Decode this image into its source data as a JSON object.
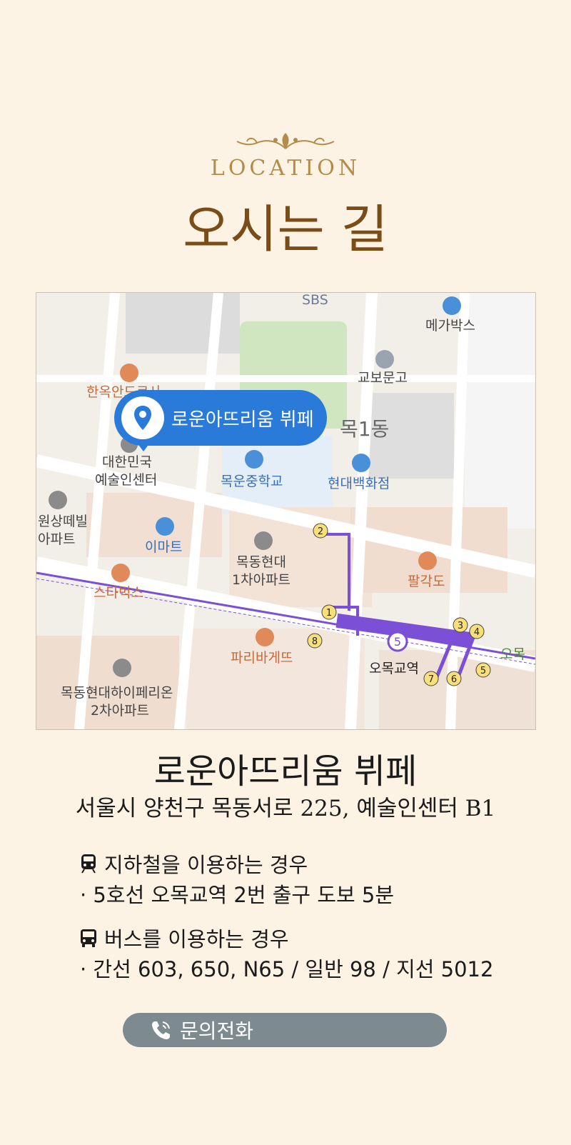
{
  "header": {
    "section_label": "LOCATION",
    "title": "오시는 길"
  },
  "map": {
    "pin_label": "로운아뜨리움 뷔페",
    "labels": {
      "sbs": "SBS",
      "megabox": "메가박스",
      "kyobo": "교보문고",
      "hanok": "한옥안드로사",
      "mok1dong": "목1동",
      "arts_center": [
        "대한민국",
        "예술인센터"
      ],
      "mogun_school": "목운중학교",
      "hyundai_dept": "현대백화점",
      "wonsang_apt": [
        "원상떼빌",
        "아파트"
      ],
      "emart": "이마트",
      "mokdong_hyundai": [
        "목동현대",
        "1차아파트"
      ],
      "palgakdo": "팔각도",
      "starbucks": "스타벅스",
      "paris": "파리바게뜨",
      "omok_station": "오목교역",
      "omok_edge": "오목",
      "imperion": [
        "목동현대하이페리온",
        "2차아파트"
      ],
      "line_num": "5",
      "exits": [
        "1",
        "2",
        "3",
        "4",
        "5",
        "6",
        "7",
        "8"
      ]
    }
  },
  "venue": {
    "name": "로운아뜨리움 뷔페",
    "address": "서울시 양천구 목동서로 225, 예술인센터 B1"
  },
  "transport": {
    "subway_heading": "지하철을 이용하는 경우",
    "subway_detail": "· 5호선 오목교역 2번 출구 도보 5분",
    "bus_heading": "버스를 이용하는 경우",
    "bus_detail": "· 간선 603, 650, N65 / 일반 98 / 지선 5012"
  },
  "contact": {
    "call_label": "문의전화",
    "icon": "phone-icon"
  },
  "colors": {
    "background": "#fdf3e4",
    "title_brown": "#7a4c17",
    "gold": "#b58b4a",
    "pin_blue": "#2a7bd9",
    "subway_line5": "#7b4fd6",
    "call_button": "#7d8a90"
  }
}
